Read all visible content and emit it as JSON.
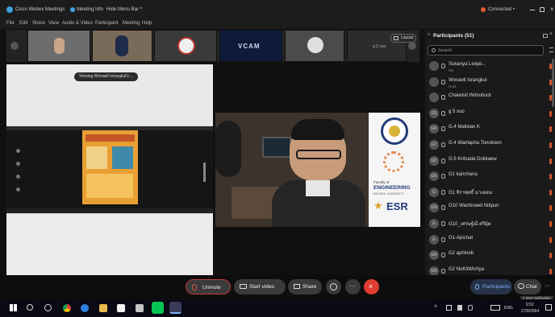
{
  "titlebar": {
    "app_title": "Cisco Webex Meetings",
    "meeting_info": "Meeting Info",
    "hide_menu": "Hide Menu Bar ^",
    "connected": "Connected •"
  },
  "menubar": {
    "items": [
      "File",
      "Edit",
      "Share",
      "View",
      "Audio & Video",
      "Participant",
      "Meeting",
      "Help"
    ]
  },
  "strip": {
    "vcam_label": "VCAM",
    "g5_label": "g 5 xuo",
    "layout_label": "Layout"
  },
  "share": {
    "viewing_label": "Viewing Worawit Israngkul's ..."
  },
  "speaker": {
    "logo_line1": "Faculty of",
    "logo_line2": "ENGINEERING",
    "logo_line3": "MAHIDOL UNIVERSITY",
    "esr_label": "ESR"
  },
  "panel": {
    "title": "Participants (51)",
    "search_placeholder": "Search",
    "participants": [
      {
        "name": "Sukanya Leejal...",
        "sub": "Me",
        "avatar": ""
      },
      {
        "name": "Worawit Israngkul",
        "sub": "Host",
        "avatar": ""
      },
      {
        "name": "Chaiwisit Wimolluck",
        "sub": "",
        "avatar": ""
      },
      {
        "name": "g 5 xuo",
        "sub": "",
        "avatar": "G5"
      },
      {
        "name": "G.4 Maliwan K",
        "sub": "",
        "avatar": "GK"
      },
      {
        "name": "G.4 Wanlapha Tonukoon",
        "sub": "",
        "avatar": "GT"
      },
      {
        "name": "G.5 Kritsada Dokkaew",
        "sub": "",
        "avatar": "GD"
      },
      {
        "name": "G1 kanchana",
        "sub": "",
        "avatar": "GK"
      },
      {
        "name": "G1 จิราพุทธิ์ มาเตอน",
        "sub": "",
        "avatar": "G"
      },
      {
        "name": "G10 Wachirawit Nitipun",
        "sub": "",
        "avatar": "GN"
      },
      {
        "name": "G10_เศรษฐ์ณี ศรีผุ้ด",
        "sub": "",
        "avatar": "G"
      },
      {
        "name": "G1-Apichat",
        "sub": "",
        "avatar": "G"
      },
      {
        "name": "G2 aphinob",
        "sub": "",
        "avatar": "GA"
      },
      {
        "name": "G2 NuKitWichya",
        "sub": "",
        "avatar": "GN"
      }
    ]
  },
  "controls": {
    "unmute": "Unmute",
    "start_video": "Start video",
    "share": "Share",
    "participants": "Participants",
    "chat": "Chat",
    "notification": "1 new notification"
  },
  "taskbar": {
    "lang": "ENG",
    "time": "9:52",
    "date": "27/8/2564"
  },
  "colors": {
    "accent_blue": "#2f7fe0",
    "end_red": "#e03c31",
    "status_orange": "#d4502c"
  }
}
